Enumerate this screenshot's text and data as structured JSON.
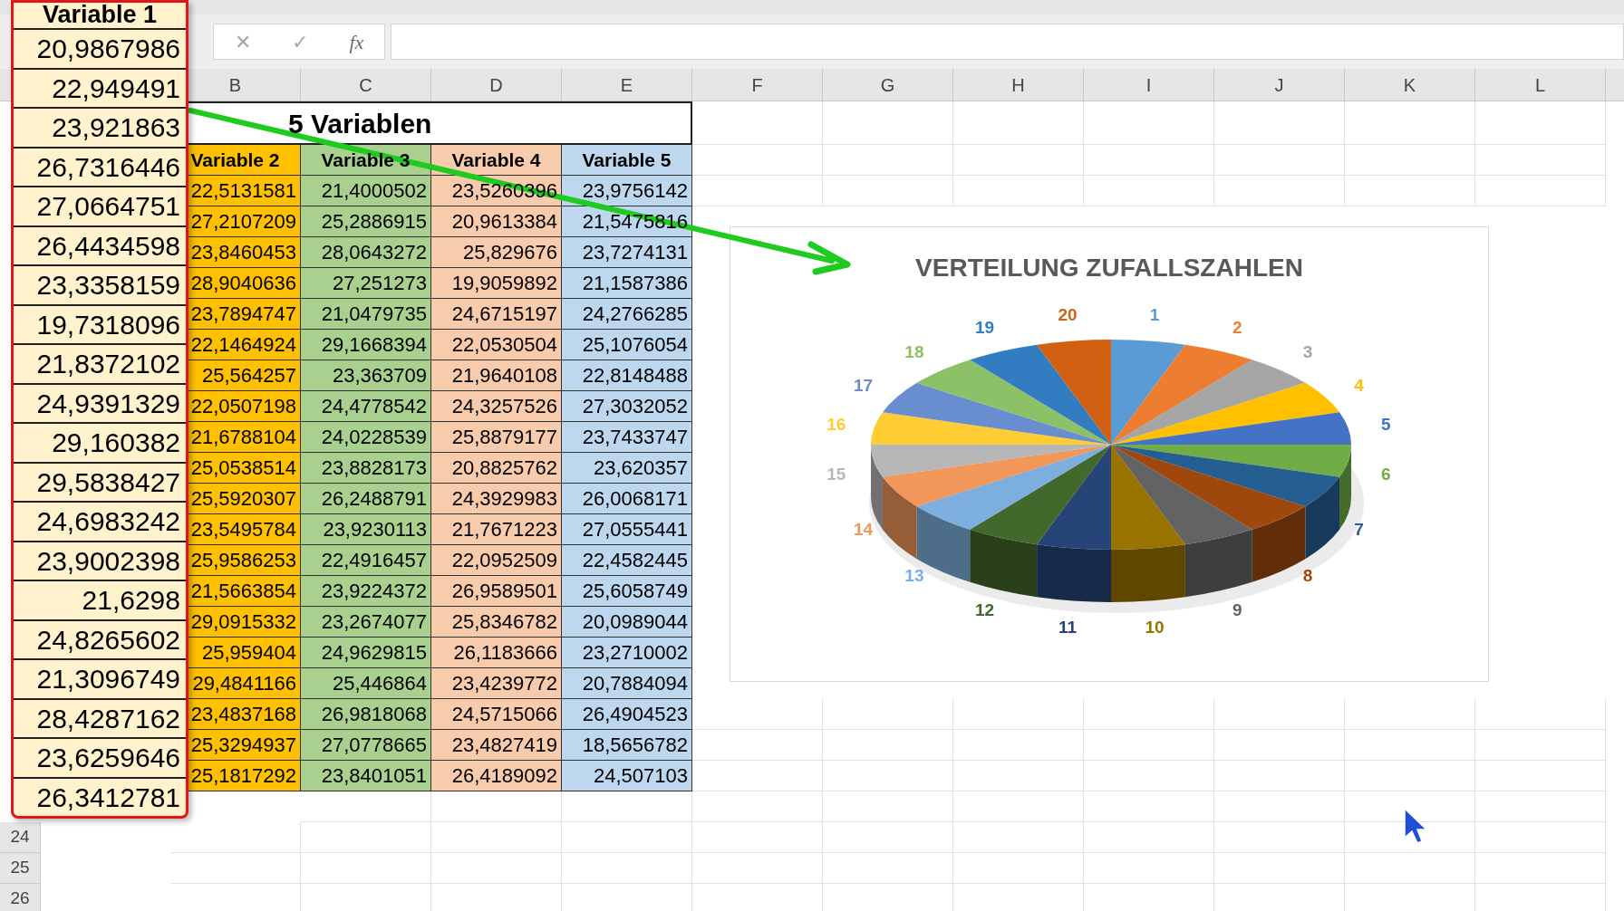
{
  "formula_bar": {
    "cancel": "✕",
    "enter": "✓",
    "function": "fx"
  },
  "column_headers": [
    "B",
    "C",
    "D",
    "E",
    "F",
    "G",
    "H",
    "I",
    "J",
    "K",
    "L"
  ],
  "row_numbers": [
    "24",
    "25",
    "26"
  ],
  "table": {
    "title": "5 Variablen",
    "columns": [
      {
        "header": "Variable 2",
        "color": "#ffc000"
      },
      {
        "header": "Variable 3",
        "color": "#a9d08e"
      },
      {
        "header": "Variable 4",
        "color": "#f8cbad"
      },
      {
        "header": "Variable 5",
        "color": "#bdd7ee"
      }
    ],
    "rows": [
      [
        "22,5131581",
        "21,4000502",
        "23,5260396",
        "23,9756142"
      ],
      [
        "27,2107209",
        "25,2886915",
        "20,9613384",
        "21,5475816"
      ],
      [
        "23,8460453",
        "28,0643272",
        "25,829676",
        "23,7274131"
      ],
      [
        "28,9040636",
        "27,251273",
        "19,9059892",
        "21,1587386"
      ],
      [
        "23,7894747",
        "21,0479735",
        "24,6715197",
        "24,2766285"
      ],
      [
        "22,1464924",
        "29,1668394",
        "22,0530504",
        "25,1076054"
      ],
      [
        "25,564257",
        "23,363709",
        "21,9640108",
        "22,8148488"
      ],
      [
        "22,0507198",
        "24,4778542",
        "24,3257526",
        "27,3032052"
      ],
      [
        "21,6788104",
        "24,0228539",
        "25,8879177",
        "23,7433747"
      ],
      [
        "25,0538514",
        "23,8828173",
        "20,8825762",
        "23,620357"
      ],
      [
        "25,5920307",
        "26,2488791",
        "24,3929983",
        "26,0068171"
      ],
      [
        "23,5495784",
        "23,9230113",
        "21,7671223",
        "27,0555441"
      ],
      [
        "25,9586253",
        "22,4916457",
        "22,0952509",
        "22,4582445"
      ],
      [
        "21,5663854",
        "23,9224372",
        "26,9589501",
        "25,6058749"
      ],
      [
        "29,0915332",
        "23,2674077",
        "25,8346782",
        "20,0989044"
      ],
      [
        "25,959404",
        "24,9629815",
        "26,1183666",
        "23,2710002"
      ],
      [
        "29,4841166",
        "25,446864",
        "23,4239772",
        "20,7884094"
      ],
      [
        "23,4837168",
        "26,9818068",
        "24,5715066",
        "26,4904523"
      ],
      [
        "25,3294937",
        "27,0778665",
        "23,4827419",
        "18,5656782"
      ],
      [
        "25,1817292",
        "23,8401051",
        "26,4189092",
        "24,507103"
      ]
    ]
  },
  "callout": {
    "header": "Variable 1",
    "values": [
      "20,9867986",
      "22,949491",
      "23,921863",
      "26,7316446",
      "27,0664751",
      "26,4434598",
      "23,3358159",
      "19,7318096",
      "21,8372102",
      "24,9391329",
      "29,160382",
      "29,5838427",
      "24,6983242",
      "23,9002398",
      "21,6298",
      "24,8265602",
      "21,3096749",
      "28,4287162",
      "23,6259646",
      "26,3412781"
    ]
  },
  "chart": {
    "title": "VERTEILUNG ZUFALLSZAHLEN",
    "slices": [
      {
        "label": "1",
        "color": "#5b9bd5"
      },
      {
        "label": "2",
        "color": "#ed7d31"
      },
      {
        "label": "3",
        "color": "#a5a5a5"
      },
      {
        "label": "4",
        "color": "#ffc000"
      },
      {
        "label": "5",
        "color": "#4472c4"
      },
      {
        "label": "6",
        "color": "#70ad47"
      },
      {
        "label": "7",
        "color": "#255e91"
      },
      {
        "label": "8",
        "color": "#9e480e"
      },
      {
        "label": "9",
        "color": "#636363"
      },
      {
        "label": "10",
        "color": "#997300"
      },
      {
        "label": "11",
        "color": "#264478"
      },
      {
        "label": "12",
        "color": "#43682b"
      },
      {
        "label": "13",
        "color": "#7cafdd"
      },
      {
        "label": "14",
        "color": "#f1975a"
      },
      {
        "label": "15",
        "color": "#b7b7b7"
      },
      {
        "label": "16",
        "color": "#ffcd33"
      },
      {
        "label": "17",
        "color": "#698ed0"
      },
      {
        "label": "18",
        "color": "#8cc168"
      },
      {
        "label": "19",
        "color": "#327dc2"
      },
      {
        "label": "20",
        "color": "#d26012"
      }
    ]
  }
}
